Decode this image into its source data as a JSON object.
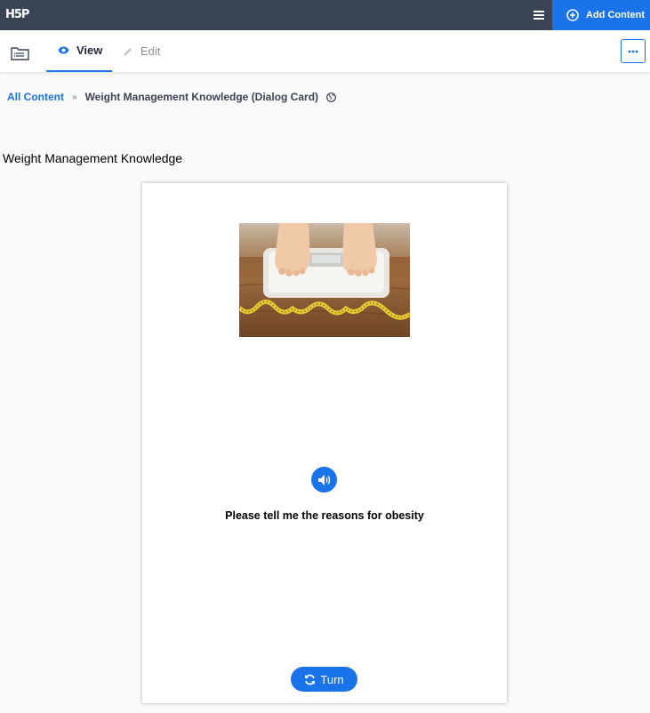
{
  "app": {
    "logo": "H5P"
  },
  "header": {
    "add_content_label": "Add Content",
    "menu_icon": "hamburger-icon",
    "add_icon": "plus-circle-icon"
  },
  "tabs": [
    {
      "label": "View",
      "icon": "eye-icon",
      "active": true
    },
    {
      "label": "Edit",
      "icon": "pencil-icon",
      "active": false
    }
  ],
  "breadcrumb": {
    "root": "All Content",
    "separator": "»",
    "current": "Weight Management Knowledge (Dialog Card)",
    "icon": "globe-icon"
  },
  "page": {
    "title": "Weight Management Knowledge"
  },
  "card": {
    "image_alt": "Feet on a bathroom scale with a measuring tape",
    "audio_icon": "speaker-icon",
    "text": "Please tell me the reasons for obesity",
    "turn_label": "Turn",
    "turn_icon": "refresh-icon"
  },
  "colors": {
    "accent": "#1a73e8",
    "topbar": "#3b4455"
  }
}
